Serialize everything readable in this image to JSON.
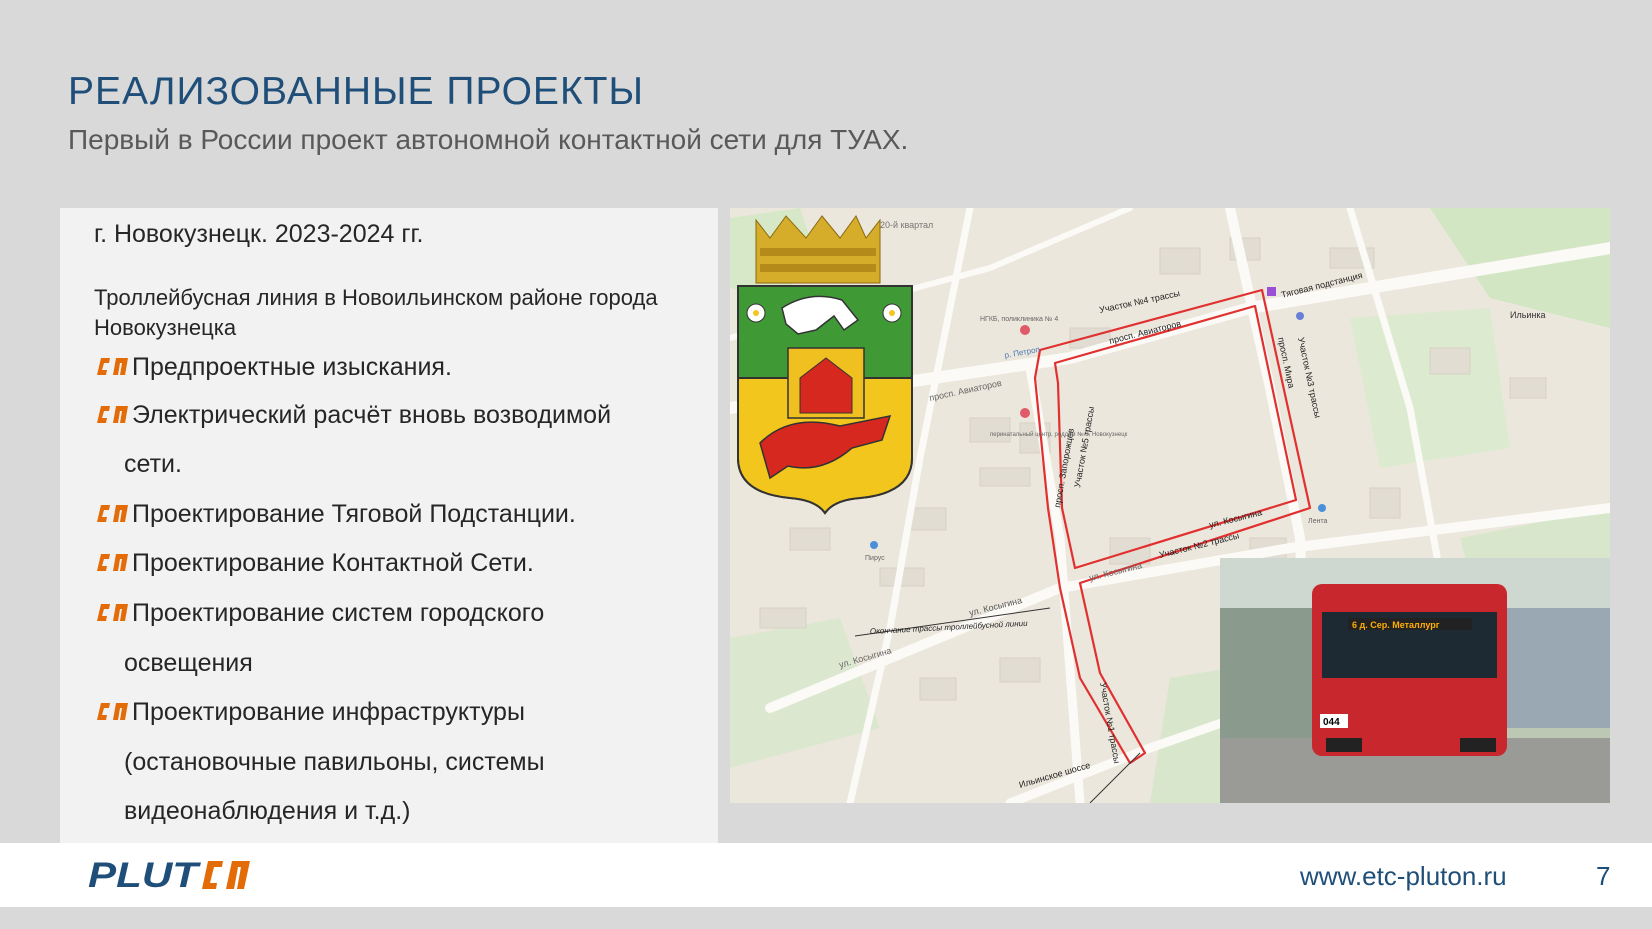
{
  "slide": {
    "title": "РЕАЛИЗОВАННЫЕ  ПРОЕКТЫ",
    "subtitle": "Первый в России проект автономной контактной сети для ТУАХ.",
    "page_number": "7"
  },
  "left_panel": {
    "city_years": "г. Новокузнецк. 2023-2024 гг.",
    "line_description": "Троллейбусная линия в Новоильинском районе города Новокузнецка",
    "bullets": [
      {
        "text": "Предпроектные изыскания."
      },
      {
        "text": "Электрический расчёт вновь возводимой",
        "cont": [
          "сети."
        ]
      },
      {
        "text": "Проектирование Тяговой Подстанции."
      },
      {
        "text": "Проектирование Контактной Сети."
      },
      {
        "text": "Проектирование систем городского",
        "cont": [
          "освещения"
        ]
      },
      {
        "text": "Проектирование инфраструктуры",
        "cont": [
          "(остановочные павильоны, системы",
          "видеонаблюдения и т.д.)"
        ]
      }
    ]
  },
  "map": {
    "labels": {
      "prosp_aviatorov_1": "просп. Авиаторов",
      "prosp_aviatorov_2": "просп. Авиаторов",
      "uch4": "Участок №4 трассы",
      "uch3": "Участок №3 трассы",
      "uch2": "Участок №2 трассы",
      "uch5": "Участок №5 трассы",
      "uch1": "Участок №1 трассы",
      "tps": "Тяговая подстанция",
      "kosygina_1": "ул. Косыгина",
      "kosygina_2": "ул. Косыгина",
      "kosygina_3": "ул. Косыгина",
      "kosygina_4": "ул. Косыгина",
      "zaporozhtsev": "просп. Запорожцев",
      "mira": "просп. Мира",
      "ilinskoe": "Ильинское шоссе",
      "end_route": "Окончание трассы троллейбусной линии",
      "ilinka": "Ильинка",
      "kvartal": "20-й квартал",
      "ngkb": "НГКБ, поликлиника № 4",
      "perinatal": "перинатальный центр, роддом № 3, Новокузнецк",
      "lenta": "Лента",
      "pirus": "Пирус",
      "r_petrop": "р. Петроп"
    },
    "bus_sign": "6  д. Сер. Металлург",
    "bus_number": "044"
  },
  "footer": {
    "logo_text": "PLUTON",
    "url": "www.etc-pluton.ru"
  },
  "colors": {
    "title_blue": "#1f4e79",
    "bullet_orange": "#e36c09",
    "route_red": "#e03030",
    "bus_red": "#c8282d"
  }
}
